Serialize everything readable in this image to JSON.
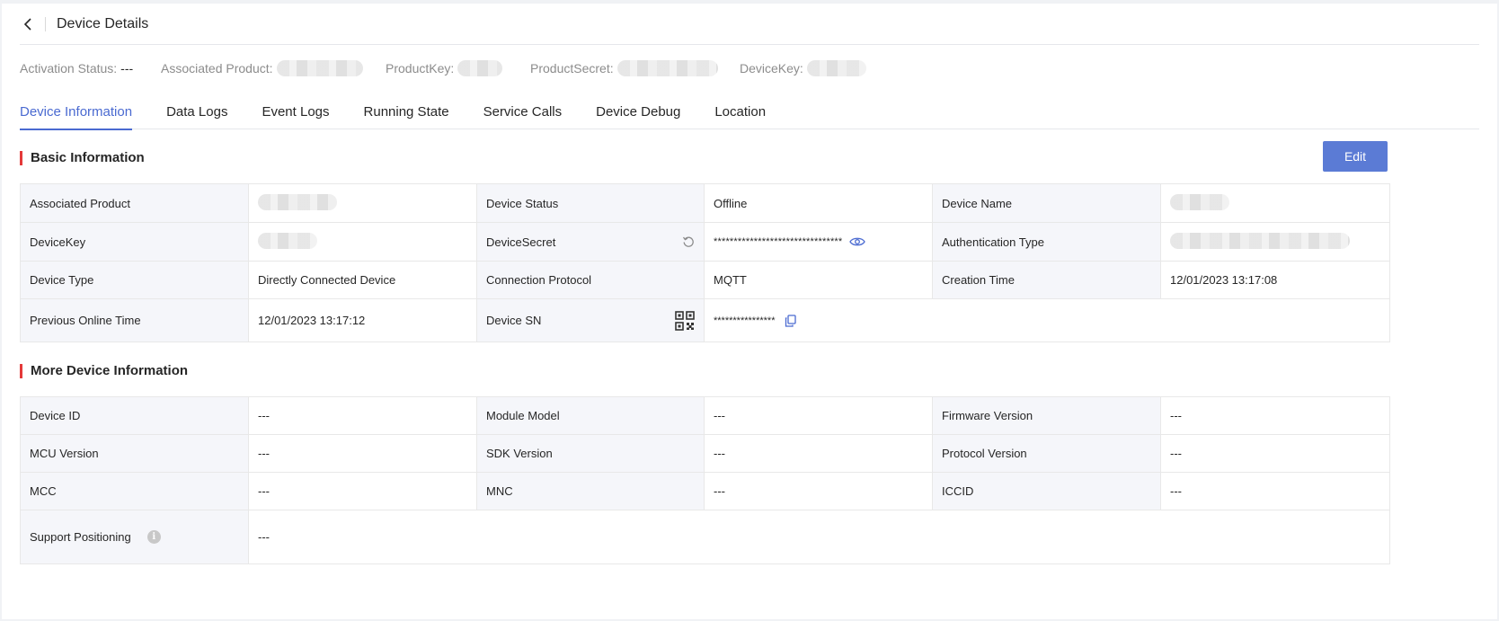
{
  "header": {
    "title": "Device Details"
  },
  "summary": {
    "activation_status_label": "Activation Status:",
    "activation_status_value": "---",
    "associated_product_label": "Associated Product:",
    "product_key_label": "ProductKey:",
    "product_secret_label": "ProductSecret:",
    "device_key_label": "DeviceKey:"
  },
  "tabs": [
    {
      "label": "Device Information"
    },
    {
      "label": "Data Logs"
    },
    {
      "label": "Event Logs"
    },
    {
      "label": "Running State"
    },
    {
      "label": "Service Calls"
    },
    {
      "label": "Device Debug"
    },
    {
      "label": "Location"
    }
  ],
  "basic": {
    "title": "Basic Information",
    "edit_label": "Edit",
    "labels": {
      "associated_product": "Associated Product",
      "device_status": "Device Status",
      "device_name": "Device Name",
      "device_key": "DeviceKey",
      "device_secret": "DeviceSecret",
      "auth_type": "Authentication Type",
      "device_type": "Device Type",
      "connection_protocol": "Connection Protocol",
      "creation_time": "Creation Time",
      "previous_online_time": "Previous Online Time",
      "device_sn": "Device SN"
    },
    "values": {
      "device_status": "Offline",
      "device_secret": "********************************",
      "device_type": "Directly Connected Device",
      "connection_protocol": "MQTT",
      "creation_time": "12/01/2023 13:17:08",
      "previous_online_time": "12/01/2023 13:17:12",
      "device_sn": "****************"
    }
  },
  "more": {
    "title": "More Device Information",
    "labels": {
      "device_id": "Device ID",
      "module_model": "Module Model",
      "firmware_version": "Firmware Version",
      "mcu_version": "MCU Version",
      "sdk_version": "SDK Version",
      "protocol_version": "Protocol Version",
      "mcc": "MCC",
      "mnc": "MNC",
      "iccid": "ICCID",
      "support_positioning": "Support Positioning"
    },
    "values": {
      "device_id": "---",
      "module_model": "---",
      "firmware_version": "---",
      "mcu_version": "---",
      "sdk_version": "---",
      "protocol_version": "---",
      "mcc": "---",
      "mnc": "---",
      "iccid": "---",
      "support_positioning": "---"
    }
  },
  "icons": {
    "back": "chevron-left-icon",
    "reset": "refresh-icon",
    "reveal": "eye-icon",
    "qr": "qr-code-icon",
    "copy": "copy-icon",
    "info": "info-icon"
  },
  "colors": {
    "accent": "#4a6ad1",
    "button": "#5b7bd5",
    "section_marker": "#e43a3a"
  }
}
